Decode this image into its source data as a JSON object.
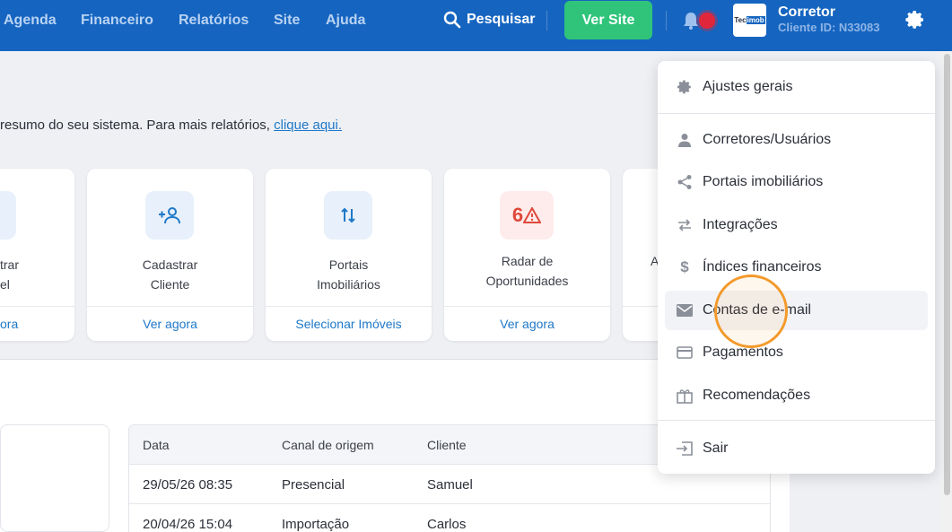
{
  "nav": {
    "items": [
      "Agenda",
      "Financeiro",
      "Relatórios",
      "Site",
      "Ajuda"
    ],
    "search_label": "Pesquisar",
    "site_button": "Ver Site",
    "logo_tec": "Tec",
    "logo_imob": "imob",
    "user_name": "Corretor",
    "user_id": "Cliente ID: N33083"
  },
  "intro": {
    "text": "resumo do seu sistema. Para mais relatórios,",
    "link": "clique aqui."
  },
  "cards": [
    {
      "title_1": "trar",
      "title_2": "el",
      "footer": "ora"
    },
    {
      "title_1": "Cadastrar",
      "title_2": "Cliente",
      "footer": "Ver agora"
    },
    {
      "title_1": "Portais",
      "title_2": "Imobiliários",
      "footer": "Selecionar Imóveis"
    },
    {
      "title_1": "Radar de",
      "title_2": "Oportunidades",
      "footer": "Ver agora",
      "badge": "6"
    },
    {
      "title_1": "A"
    }
  ],
  "table": {
    "headers": [
      "Data",
      "Canal de origem",
      "Cliente"
    ],
    "rows": [
      [
        "29/05/26 08:35",
        "Presencial",
        "Samuel"
      ],
      [
        "20/04/26 15:04",
        "Importação",
        "Carlos"
      ]
    ]
  },
  "dropdown": {
    "items": [
      {
        "label": "Ajustes gerais",
        "icon": "gear-icon"
      },
      {
        "label": "Corretores/Usuários",
        "icon": "person-icon"
      },
      {
        "label": "Portais imobiliários",
        "icon": "share-icon"
      },
      {
        "label": "Integrações",
        "icon": "swap-icon"
      },
      {
        "label": "Índices financeiros",
        "icon": "dollar-icon"
      },
      {
        "label": "Contas de e-mail",
        "icon": "mail-icon"
      },
      {
        "label": "Pagamentos",
        "icon": "card-icon"
      },
      {
        "label": "Recomendações",
        "icon": "gift-icon"
      },
      {
        "label": "Sair",
        "icon": "logout-icon"
      }
    ]
  },
  "colors": {
    "topbar": "#1565c0",
    "site_button": "#2fc47a",
    "link": "#1e78c8",
    "cursor_ring": "#f39a2b",
    "badge_red": "#e0483a"
  }
}
